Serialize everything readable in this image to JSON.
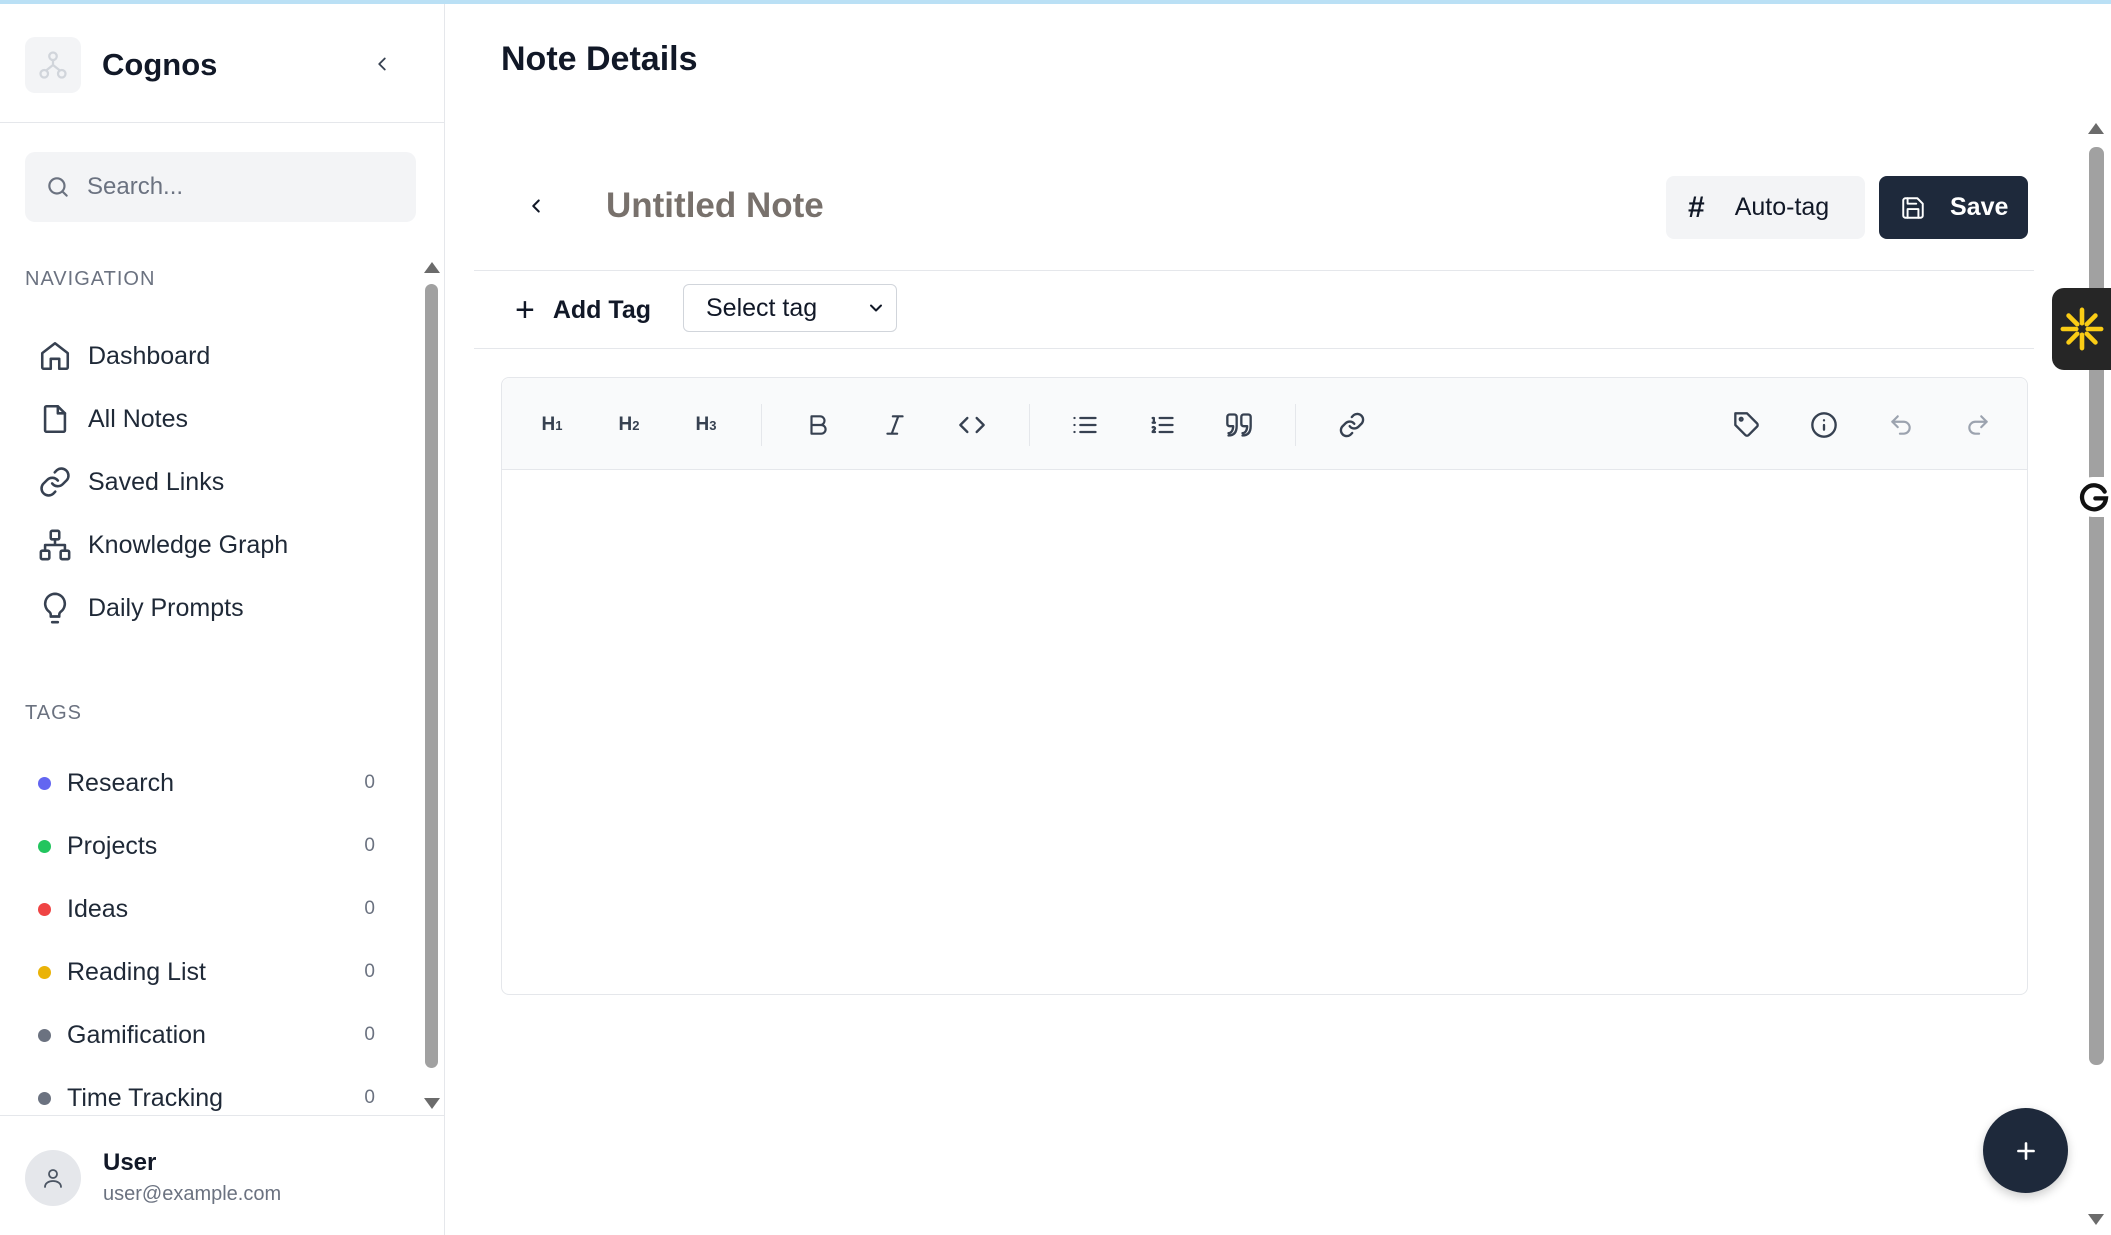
{
  "app": {
    "name": "Cognos"
  },
  "search": {
    "placeholder": "Search..."
  },
  "navigation": {
    "label": "NAVIGATION",
    "items": [
      {
        "label": "Dashboard",
        "icon": "home-icon"
      },
      {
        "label": "All Notes",
        "icon": "file-icon"
      },
      {
        "label": "Saved Links",
        "icon": "link-icon"
      },
      {
        "label": "Knowledge Graph",
        "icon": "graph-icon"
      },
      {
        "label": "Daily Prompts",
        "icon": "lightbulb-icon"
      }
    ]
  },
  "tags": {
    "label": "TAGS",
    "items": [
      {
        "label": "Research",
        "count": "0",
        "color": "#6366f1"
      },
      {
        "label": "Projects",
        "count": "0",
        "color": "#22c55e"
      },
      {
        "label": "Ideas",
        "count": "0",
        "color": "#ef4444"
      },
      {
        "label": "Reading List",
        "count": "0",
        "color": "#eab308"
      },
      {
        "label": "Gamification",
        "count": "0",
        "color": "#6b7280"
      },
      {
        "label": "Time Tracking",
        "count": "0",
        "color": "#6b7280"
      }
    ]
  },
  "user": {
    "name": "User",
    "email": "user@example.com"
  },
  "page": {
    "title": "Note Details"
  },
  "note": {
    "title_placeholder": "Untitled Note"
  },
  "actions": {
    "autotag_label": "Auto-tag",
    "save_label": "Save"
  },
  "tagbar": {
    "add_tag_label": "Add Tag",
    "select_value": "Select tag"
  },
  "toolbar": {
    "h1": "H1",
    "h2": "H2",
    "h3": "H3",
    "buttons": [
      "heading-1",
      "heading-2",
      "heading-3",
      "bold",
      "italic",
      "code",
      "bullet-list",
      "ordered-list",
      "quote",
      "link",
      "tag",
      "info",
      "undo",
      "redo"
    ]
  },
  "colors": {
    "primary": "#1e293b",
    "accent_widget": "#facc15"
  }
}
